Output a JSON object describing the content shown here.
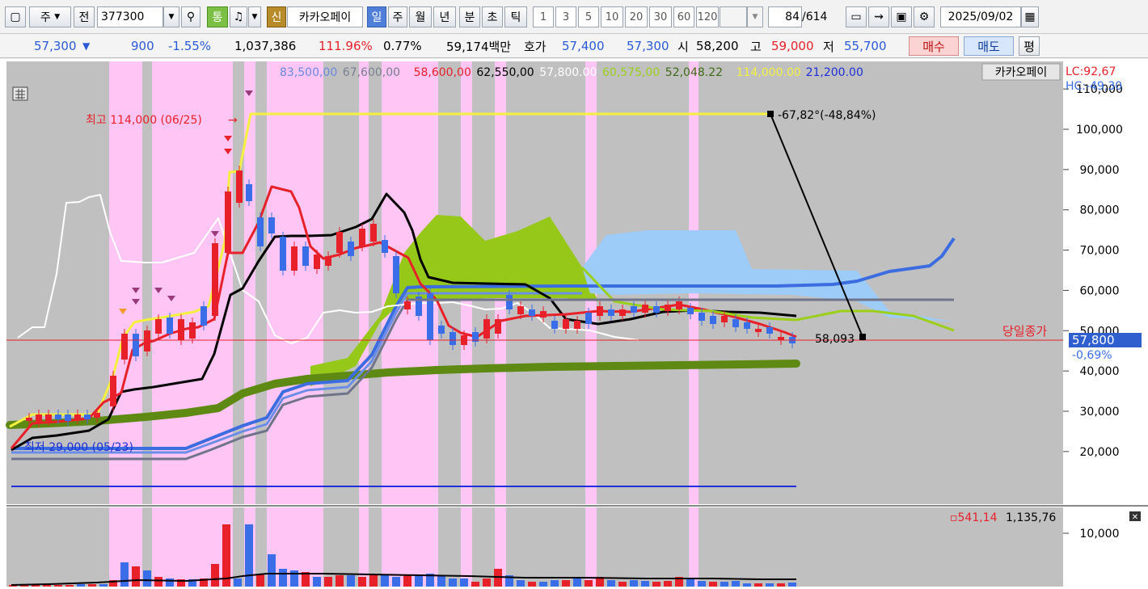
{
  "toolbar": {
    "type_label": "주",
    "prev_label": "전",
    "stock_code": "377300",
    "tong_label": "통",
    "new_label": "신",
    "stock_name": "카카오페이",
    "periods": [
      "일",
      "주",
      "월",
      "년",
      "분",
      "초",
      "틱"
    ],
    "active_period": "일",
    "intervals": [
      "1",
      "3",
      "5",
      "10",
      "20",
      "30",
      "60",
      "120"
    ],
    "page_index": "84",
    "page_total": "/614",
    "date": "2025/09/02"
  },
  "quote": {
    "price": "57,300",
    "change_arrow": "▼",
    "change": "900",
    "change_pct": "-1.55%",
    "volume": "1,037,386",
    "volume_ratio": "111.96%",
    "turnover": "0.77%",
    "amount": "59,174백만",
    "hoga_label": "호가",
    "ask": "57,400",
    "bid": "57,300",
    "open_label": "시",
    "open": "58,200",
    "high_label": "고",
    "high": "59,000",
    "low_label": "저",
    "low": "55,700",
    "buy_label": "매수",
    "sell_label": "매도",
    "eval_label": "평"
  },
  "legend": {
    "items": [
      {
        "text": "83,500,00",
        "color": "#6a88e0"
      },
      {
        "text": "67,600,00",
        "color": "#7a7e90"
      },
      {
        "text": "58,600,00",
        "color": "#e8202a"
      },
      {
        "text": "62,550,00",
        "color": "#000000"
      },
      {
        "text": "57,800.00",
        "color": "#ffffff"
      },
      {
        "text": "60,575,00",
        "color": "#9ccf1a"
      },
      {
        "text": "52,048.22",
        "color": "#3f6a16"
      },
      {
        "text": "114,000.00",
        "color": "#f4f040"
      },
      {
        "text": "21,200.00",
        "color": "#1c2fd8"
      }
    ],
    "name": "카카오페이",
    "lc": "LC:92,67",
    "hc": "HC:-49,30"
  },
  "annotations": {
    "high_label": "최고 114,000 (06/25)",
    "low_label": "최저 29,000 (05/23)",
    "angle_label": "-67,82°(-48,84%)",
    "trend_end_value": "58,093",
    "close_label": "당일종가",
    "last_price": "57,800",
    "last_pct": "-0,69%"
  },
  "price_axis": [
    "110,000",
    "100,000",
    "90,000",
    "80,000",
    "70,000",
    "60,000",
    "50,000",
    "40,000",
    "30,000",
    "20,000"
  ],
  "volume_axis": [
    "10,000"
  ],
  "volume_legend": {
    "ma1": "541,14",
    "ma2": "1,135,76"
  },
  "colors": {
    "up": "#e8202a",
    "down": "#3a6ee8",
    "background": "#c0c0c0",
    "highlight": "#ffc6f5",
    "price_line": "#e8202a"
  }
}
